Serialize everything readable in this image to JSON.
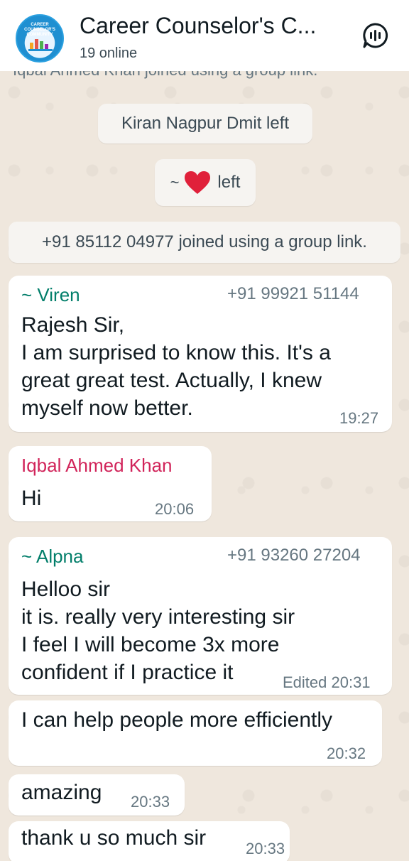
{
  "header": {
    "title": "Career Counselor's C...",
    "online": "19 online",
    "avatar_text": "CAREER COUNSELOR'S COMMUNITY",
    "call_icon": "group-voice-call-icon"
  },
  "faded_line": "Iqbal Ahmed Khan joined using a group link.",
  "system": {
    "left1": "Kiran Nagpur Dmit left",
    "left2_prefix": "~",
    "left2_suffix": "left",
    "joined": "+91 85112 04977 joined using a group link."
  },
  "messages": [
    {
      "sender": "~ Viren",
      "phone": "+91 99921 51144",
      "text": "Rajesh Sir,\nI am surprised to know this. It's a\ngreat great test. Actually, I knew\nmyself now better.",
      "time": "19:27"
    },
    {
      "sender": "Iqbal Ahmed Khan",
      "text": "Hi",
      "time": "20:06"
    },
    {
      "sender": "~ Alpna",
      "phone": "+91 93260 27204",
      "text": "Helloo sir\nit is. really very interesting sir\nI feel I will become  3x more\nconfident if I practice it",
      "time": "Edited 20:31"
    },
    {
      "text": "I can help people more efficiently",
      "time": "20:32"
    },
    {
      "text": "amazing",
      "time": "20:33"
    },
    {
      "text": "thank u so much sir",
      "time": "20:33"
    }
  ],
  "colors": {
    "viren": "#027e6a",
    "iqbal": "#d1245a",
    "alpna": "#027e6a",
    "heart": "#e0203a"
  }
}
